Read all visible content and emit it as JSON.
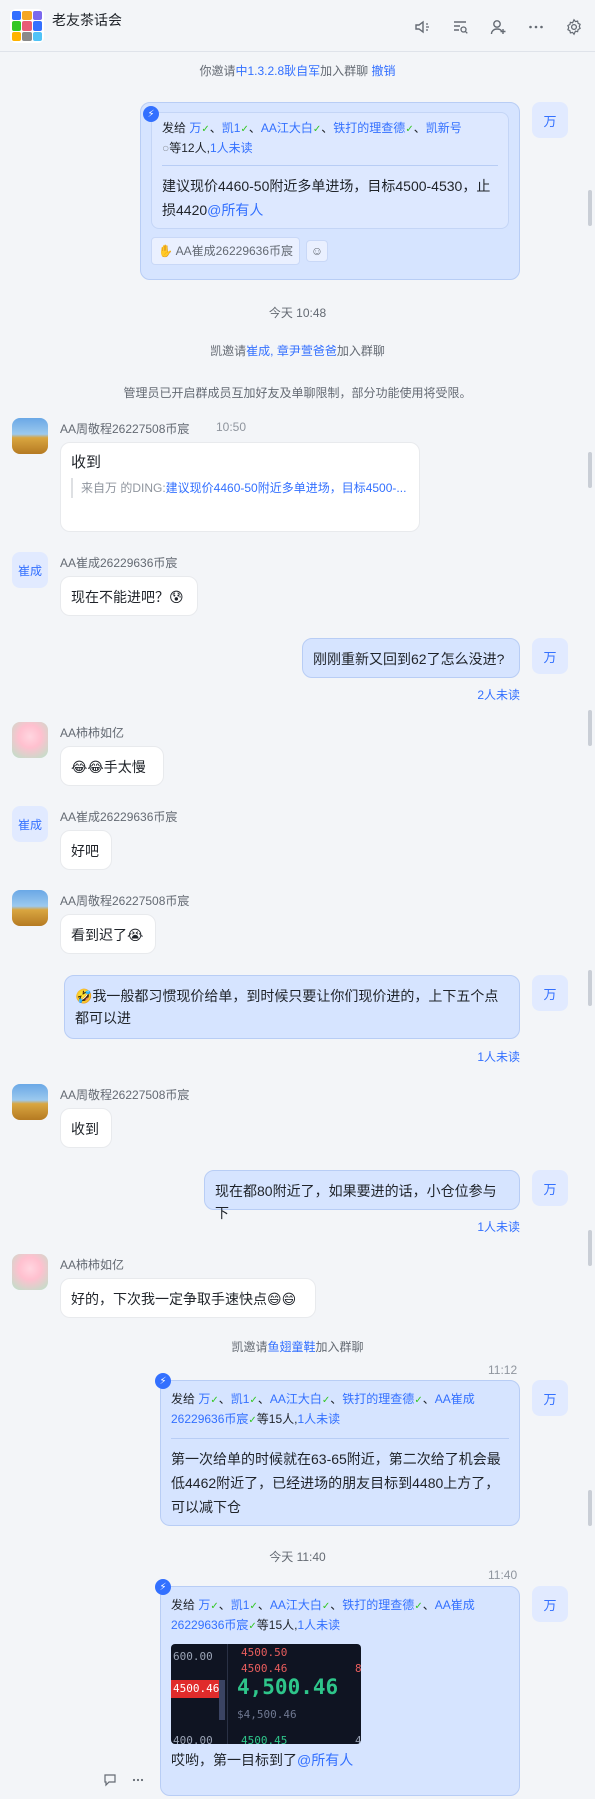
{
  "header": {
    "title": "老友茶话会",
    "icons": [
      "speaker-icon",
      "search-chat-icon",
      "add-member-icon",
      "more-icon",
      "settings-icon"
    ]
  },
  "sys1": {
    "prefix": "你邀请",
    "link": "中1.3.2.8耿自军",
    "suffix": "加入群聊",
    "action": "撤销"
  },
  "ding1": {
    "avatar": "万",
    "head_prefix": "发给",
    "names": [
      "万",
      "凯1",
      "AA江大白",
      "铁打的理查德",
      "凯新号"
    ],
    "head_suffix": "等12人,",
    "unread": "1人未读",
    "body": "建议现价4460-50附近多单进场，目标4500-4530，止损4420",
    "mention": "@所有人",
    "reaction": "AA崔成26229636币宸"
  },
  "time1": "今天 10:48",
  "sys2": {
    "prefix": "凯邀请",
    "link": "崔成, 章尹萱爸爸",
    "suffix": "加入群聊"
  },
  "sys3": "管理员已开启群成员互加好友及单聊限制，部分功能使用将受限。",
  "msg_zhou1": {
    "sender": "AA周敬程26227508币宸",
    "time": "10:50",
    "text": "收到",
    "quote_prefix": "来自万 的DING:",
    "quote_link": "建议现价4460-50附近多单进场，目标4500-..."
  },
  "msg_cui1": {
    "avatar": "崔成",
    "sender": "AA崔成26229636币宸",
    "text": "现在不能进吧？😰"
  },
  "msg_wan1": {
    "avatar": "万",
    "text": "刚刚重新又回到62了怎么没进?",
    "read": "2人未读"
  },
  "msg_shi1": {
    "sender": "AA柿柿如亿",
    "text": "😂😂手太慢"
  },
  "msg_cui2": {
    "avatar": "崔成",
    "sender": "AA崔成26229636币宸",
    "text": "好吧"
  },
  "msg_zhou2": {
    "sender": "AA周敬程26227508币宸",
    "text": "看到迟了😭"
  },
  "msg_wan2": {
    "avatar": "万",
    "text": "🤣我一般都习惯现价给单，到时候只要让你们现价进的，上下五个点都可以进",
    "read": "1人未读"
  },
  "msg_zhou3": {
    "sender": "AA周敬程26227508币宸",
    "text": "收到"
  },
  "msg_wan3": {
    "avatar": "万",
    "text": "现在都80附近了，如果要进的话，小仓位参与下",
    "read": "1人未读"
  },
  "msg_shi2": {
    "sender": "AA柿柿如亿",
    "text": "好的，下次我一定争取手速快点😄😄"
  },
  "sys4": {
    "prefix": "凯邀请",
    "link": "鱼翅童鞋",
    "suffix": "加入群聊"
  },
  "ding2": {
    "time": "11:12",
    "avatar": "万",
    "head_prefix": "发给",
    "names": [
      "万",
      "凯1",
      "AA江大白",
      "铁打的理查德",
      "AA崔成26229636币宸"
    ],
    "head_suffix": "等15人,",
    "unread": "1人未读",
    "body": "第一次给单的时候就在63-65附近，第二次给了机会最低4462附近了，已经进场的朋友目标到4480上方了，可以减下仓"
  },
  "time2": "今天 11:40",
  "ding3": {
    "time": "11:40",
    "avatar": "万",
    "head_prefix": "发给",
    "names": [
      "万",
      "凯1",
      "AA江大白",
      "铁打的理查德",
      "AA崔成26229636币宸"
    ],
    "head_suffix": "等15人,",
    "unread": "1人未读",
    "image": {
      "row1_left": "600.00",
      "row1_right": "4500.50",
      "row2_right": "4500.46",
      "row2_far": "8",
      "left_tag": "4500.46",
      "big_price": "4,500.46",
      "sub_price": "$4,500.46",
      "row_bottom_left": "400.00",
      "row_bottom_right": "4500.45",
      "row_bottom_far": "4"
    },
    "body": "哎哟，第一目标到了",
    "mention": "@所有人"
  },
  "float_icons": [
    "comment-icon",
    "more-icon"
  ]
}
